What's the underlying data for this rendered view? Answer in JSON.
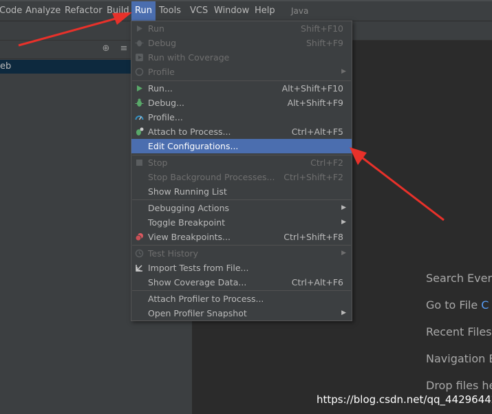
{
  "menubar": {
    "items": [
      "Code",
      "Analyze",
      "Refactor",
      "Build",
      "Run",
      "Tools",
      "VCS",
      "Window",
      "Help"
    ],
    "project": "Java"
  },
  "project_panel": {
    "row_text": "eb"
  },
  "run_menu": {
    "items": [
      {
        "label": "Run",
        "shortcut": "Shift+F10"
      },
      {
        "label": "Debug",
        "shortcut": "Shift+F9"
      },
      {
        "label": "Run with Coverage",
        "shortcut": ""
      },
      {
        "label": "Profile",
        "shortcut": ""
      },
      {
        "label": "Run...",
        "shortcut": "Alt+Shift+F10"
      },
      {
        "label": "Debug...",
        "shortcut": "Alt+Shift+F9"
      },
      {
        "label": "Profile...",
        "shortcut": ""
      },
      {
        "label": "Attach to Process...",
        "shortcut": "Ctrl+Alt+F5"
      },
      {
        "label": "Edit Configurations...",
        "shortcut": ""
      },
      {
        "label": "Stop",
        "shortcut": "Ctrl+F2"
      },
      {
        "label": "Stop Background Processes...",
        "shortcut": "Ctrl+Shift+F2"
      },
      {
        "label": "Show Running List",
        "shortcut": ""
      },
      {
        "label": "Debugging Actions",
        "shortcut": ""
      },
      {
        "label": "Toggle Breakpoint",
        "shortcut": ""
      },
      {
        "label": "View Breakpoints...",
        "shortcut": "Ctrl+Shift+F8"
      },
      {
        "label": "Test History",
        "shortcut": ""
      },
      {
        "label": "Import Tests from File...",
        "shortcut": ""
      },
      {
        "label": "Show Coverage Data...",
        "shortcut": "Ctrl+Alt+F6"
      },
      {
        "label": "Attach Profiler to Process...",
        "shortcut": ""
      },
      {
        "label": "Open Profiler Snapshot",
        "shortcut": ""
      }
    ]
  },
  "editor_hints": {
    "search": "Search Every",
    "goto_file": "Go to File",
    "goto_file_shortcut": "C",
    "recent_files": "Recent Files",
    "navigation_bar": "Navigation B",
    "drop_files": "Drop files he"
  },
  "watermark": "https://blog.csdn.net/qq_44296442",
  "colors": {
    "menu_bg": "#3c3f41",
    "selection": "#4b6eaf",
    "annotation_arrow": "#e8312a",
    "run_icon": "#59a869",
    "breakpoint_icon": "#db5860"
  }
}
